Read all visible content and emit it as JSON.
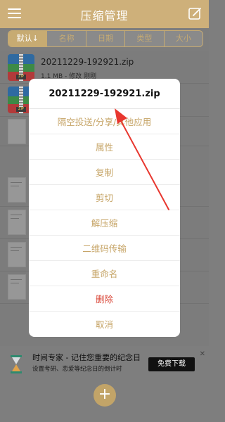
{
  "header": {
    "title": "压缩管理",
    "icons": {
      "menu": "menu-icon",
      "edit": "edit-icon"
    }
  },
  "sort_tabs": [
    {
      "label": "默认↓",
      "active": true
    },
    {
      "label": "名称",
      "active": false
    },
    {
      "label": "日期",
      "active": false
    },
    {
      "label": "类型",
      "active": false
    },
    {
      "label": "大小",
      "active": false
    }
  ],
  "files": [
    {
      "name": "20211229-192921.zip",
      "meta": "1.1 MB - 修改 刚刚"
    }
  ],
  "dialog": {
    "title": "20211229-192921.zip",
    "items": [
      {
        "label": "隔空投送/分享/其他应用"
      },
      {
        "label": "属性"
      },
      {
        "label": "复制"
      },
      {
        "label": "剪切"
      },
      {
        "label": "解压缩"
      },
      {
        "label": "二维码传输"
      },
      {
        "label": "重命名"
      },
      {
        "label": "删除"
      },
      {
        "label": "取消"
      }
    ]
  },
  "ad": {
    "title": "时间专家 - 记住您重要的纪念日",
    "subtitle": "设置考研、恋爱等纪念日的倒计时",
    "button": "免费下载",
    "close": "✕"
  },
  "fab": {
    "label": "+"
  },
  "colors": {
    "accent": "#c6a466",
    "danger": "#d94536",
    "annotation": "#e8372f"
  }
}
